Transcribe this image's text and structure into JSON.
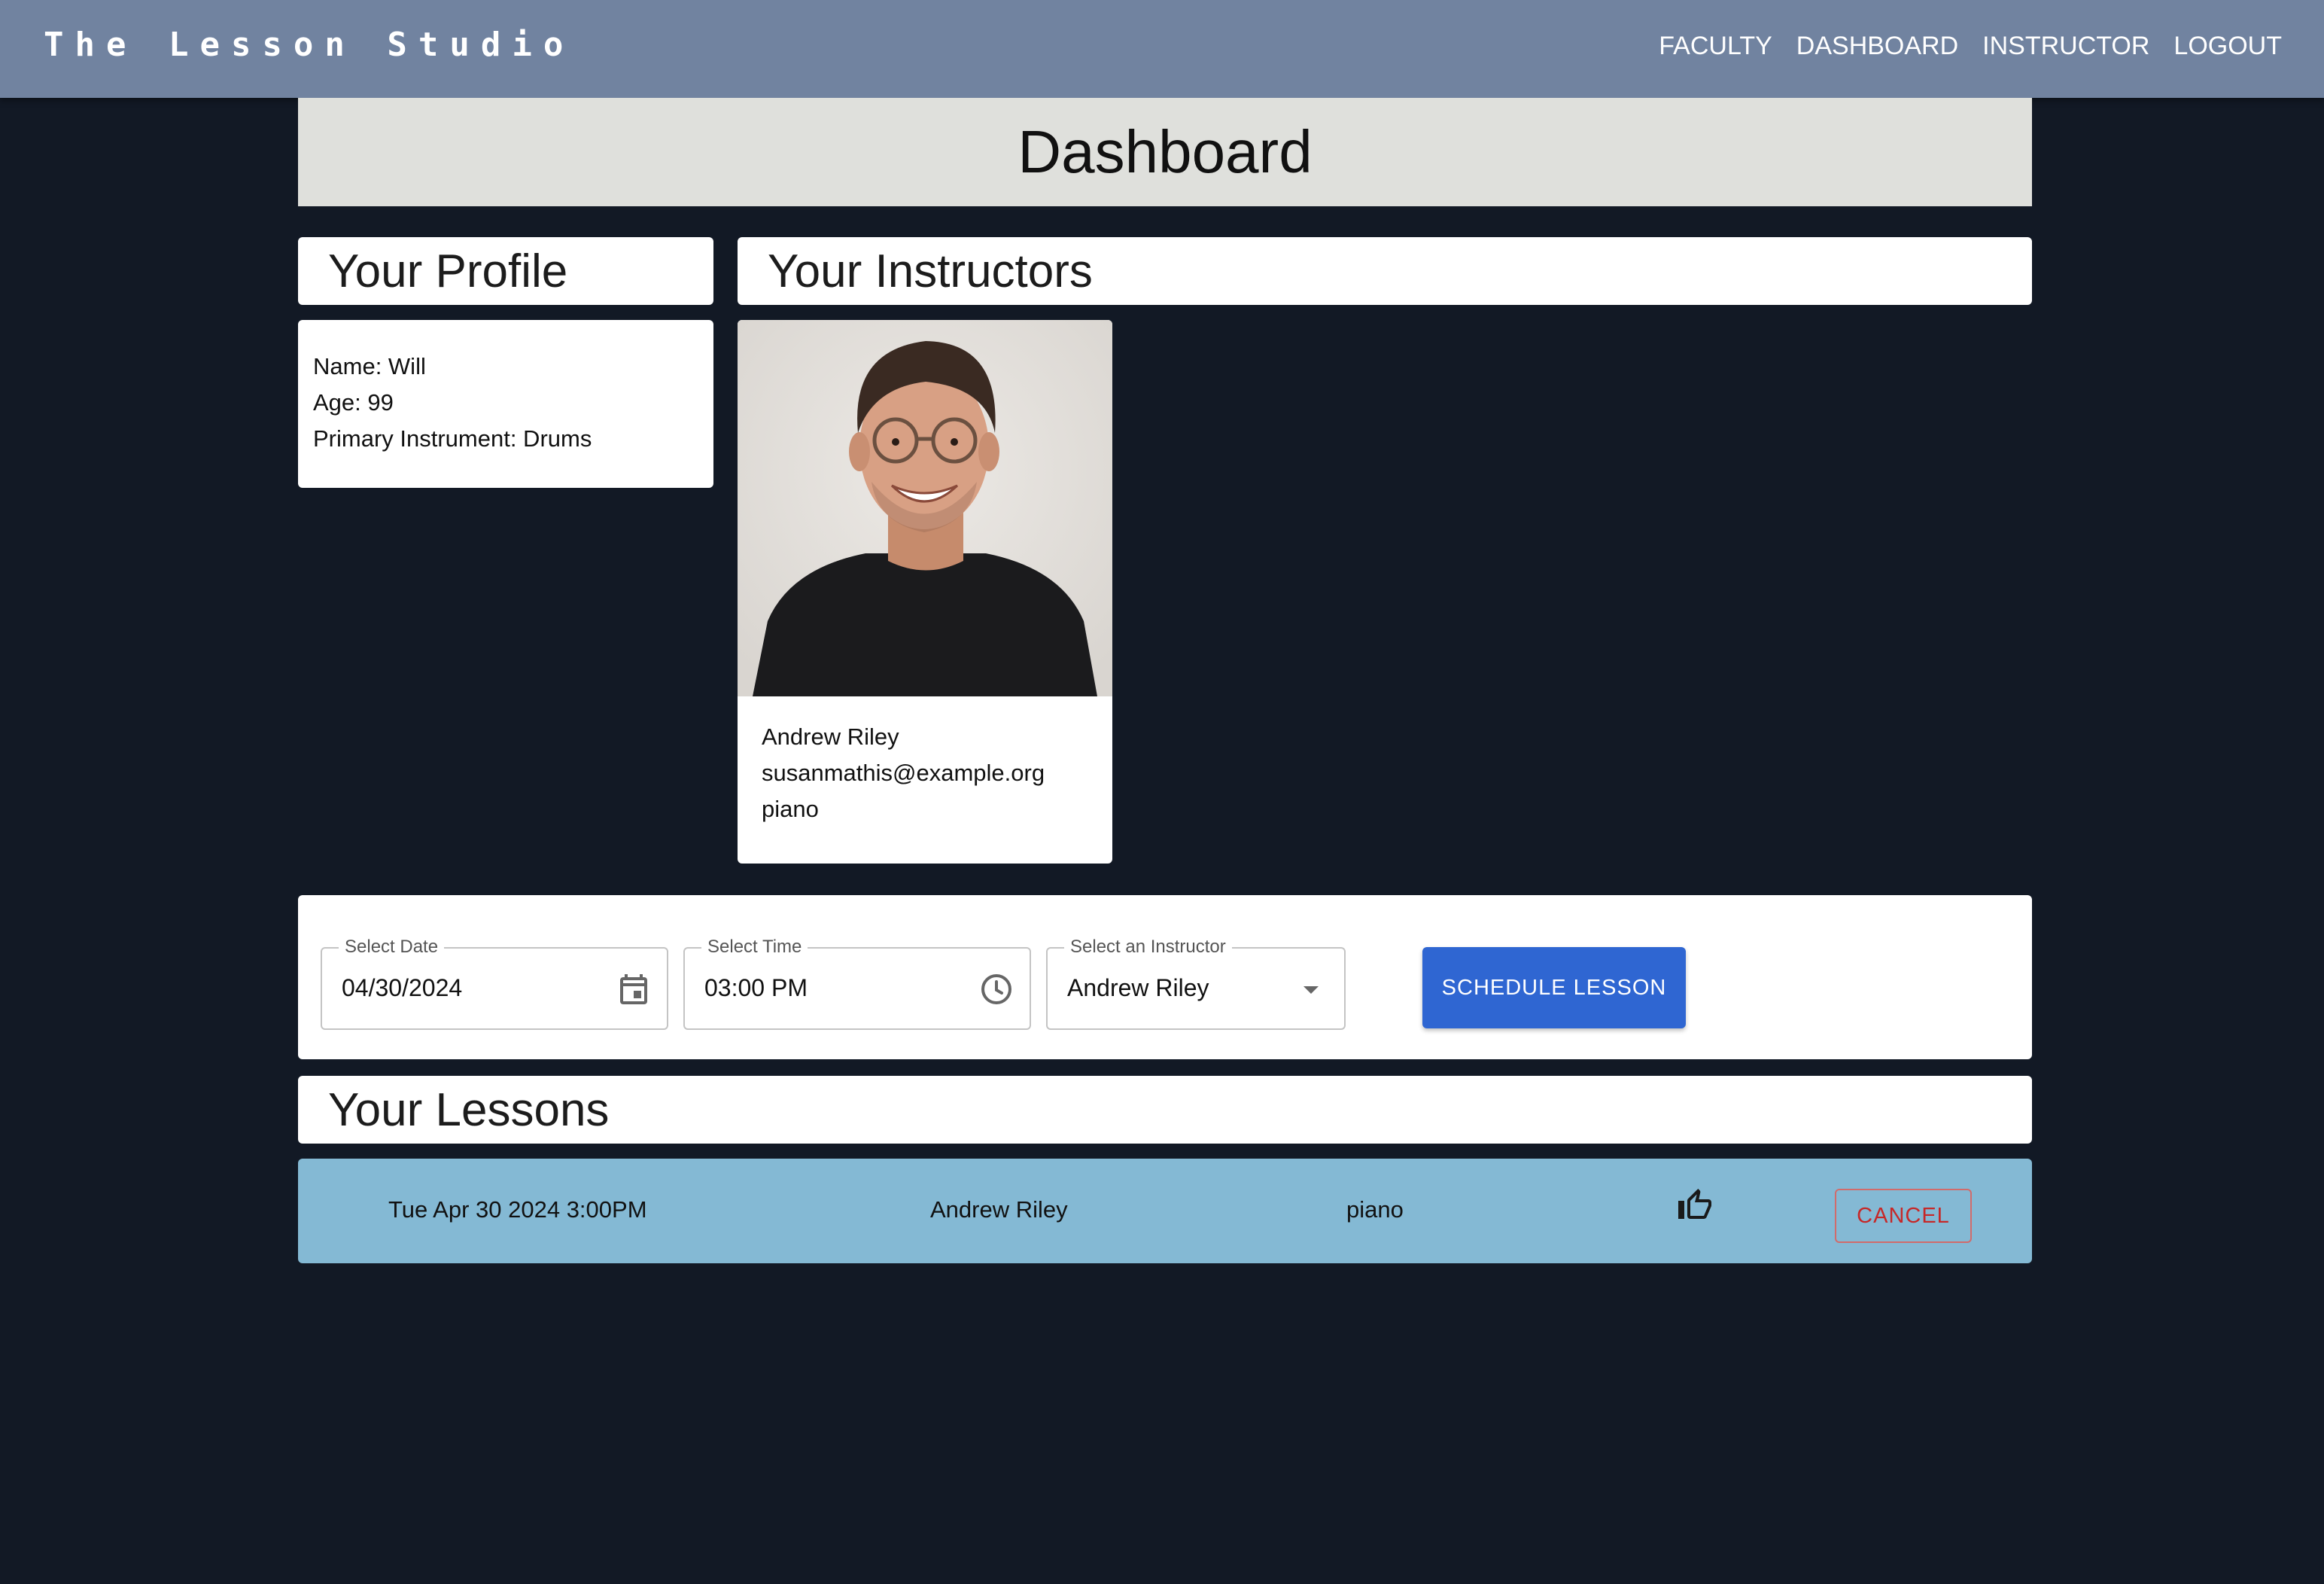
{
  "nav": {
    "brand": "The Lesson Studio",
    "links": [
      "FACULTY",
      "DASHBOARD",
      "INSTRUCTOR",
      "LOGOUT"
    ]
  },
  "page": {
    "title": "Dashboard"
  },
  "profile": {
    "title": "Your Profile",
    "name": "Name: Will",
    "age": "Age: 99",
    "instrument": "Primary Instrument: Drums"
  },
  "instructors": {
    "title": "Your Instructors",
    "items": [
      {
        "name": "Andrew Riley",
        "email": "susanmathis@example.org",
        "instrument": "piano",
        "photo": "instructor-photo"
      }
    ]
  },
  "schedule": {
    "date_label": "Select Date",
    "date_value": "04/30/2024",
    "time_label": "Select Time",
    "time_value": "03:00 PM",
    "instructor_label": "Select an Instructor",
    "instructor_value": "Andrew Riley",
    "button_label": "SCHEDULE LESSON",
    "icons": [
      "calendar-icon",
      "clock-icon",
      "caret-down-icon"
    ]
  },
  "lessons": {
    "title": "Your Lessons",
    "items": [
      {
        "datetime": "Tue Apr 30 2024 3:00PM",
        "instructor": "Andrew Riley",
        "instrument": "piano",
        "status_icon": "thumbs-up-icon",
        "cancel_label": "CANCEL"
      }
    ]
  },
  "colors": {
    "background": "#121925",
    "topbar": "#7183a0",
    "header": "#dfe0dc",
    "primary_button": "#2f66d2",
    "lesson_row": "#84b9d4",
    "cancel": "#c62828"
  }
}
